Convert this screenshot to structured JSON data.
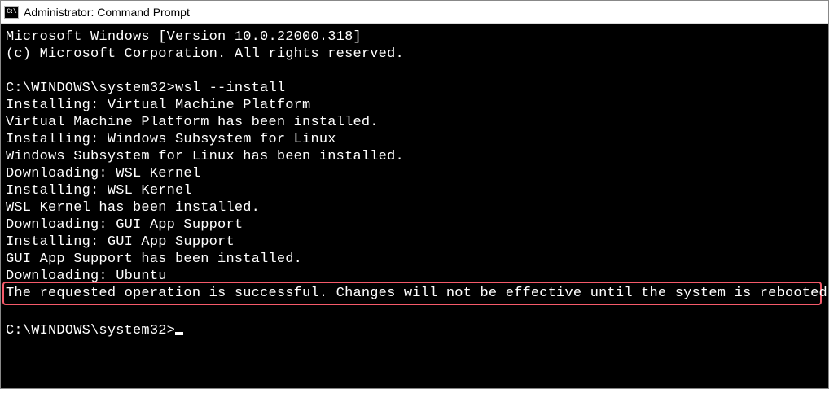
{
  "titlebar": {
    "icon_label": "C:\\",
    "title": "Administrator: Command Prompt"
  },
  "terminal": {
    "header1": "Microsoft Windows [Version 10.0.22000.318]",
    "header2": "(c) Microsoft Corporation. All rights reserved.",
    "prompt1": "C:\\WINDOWS\\system32>",
    "command1": "wsl --install",
    "lines": [
      "Installing: Virtual Machine Platform",
      "Virtual Machine Platform has been installed.",
      "Installing: Windows Subsystem for Linux",
      "Windows Subsystem for Linux has been installed.",
      "Downloading: WSL Kernel",
      "Installing: WSL Kernel",
      "WSL Kernel has been installed.",
      "Downloading: GUI App Support",
      "Installing: GUI App Support",
      "GUI App Support has been installed.",
      "Downloading: Ubuntu"
    ],
    "success_msg": "The requested operation is successful. Changes will not be effective until the system is rebooted.",
    "prompt2": "C:\\WINDOWS\\system32>"
  }
}
